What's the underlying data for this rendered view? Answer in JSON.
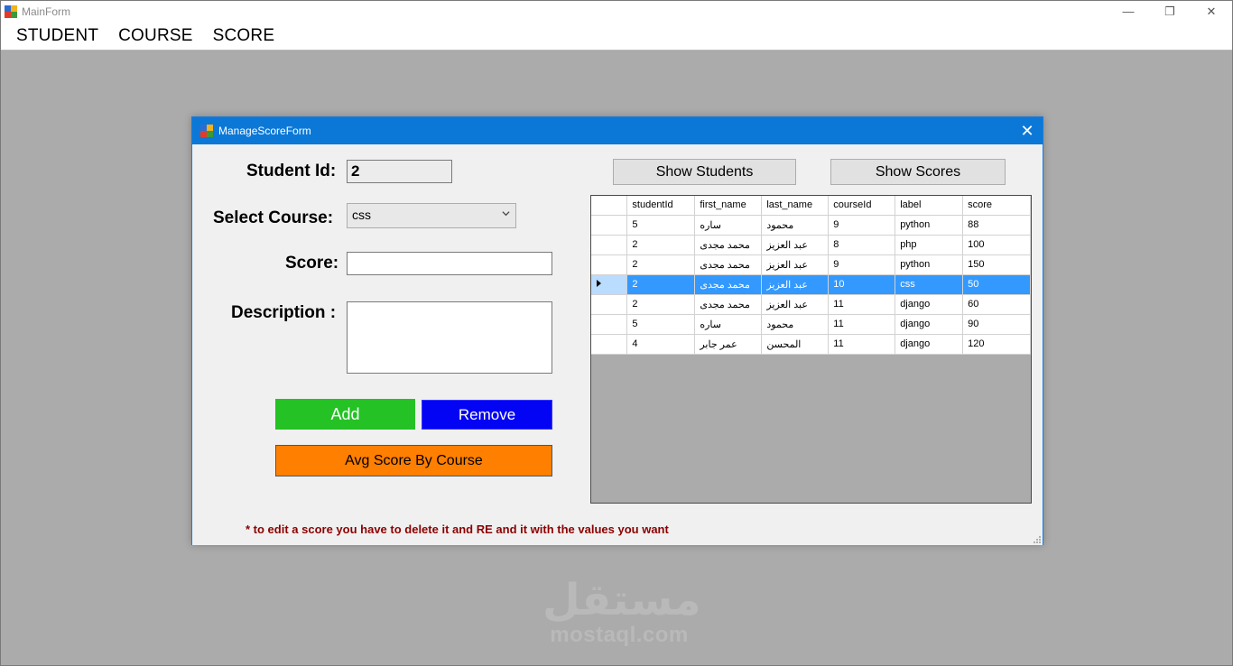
{
  "main_window": {
    "title": "MainForm",
    "controls": {
      "minimize": "—",
      "restore": "❐",
      "close": "✕"
    },
    "menu": [
      "STUDENT",
      "COURSE",
      "SCORE"
    ]
  },
  "child_window": {
    "title": "ManageScoreForm",
    "close": "✕",
    "labels": {
      "student_id": "Student Id:",
      "select_course": "Select Course:",
      "score": "Score:",
      "description": "Description :"
    },
    "fields": {
      "student_id_value": "2",
      "course_selected": "css",
      "score_value": "",
      "description_value": ""
    },
    "buttons": {
      "show_students": "Show Students",
      "show_scores": "Show Scores",
      "add": "Add",
      "remove": "Remove",
      "avg": "Avg Score By Course"
    },
    "grid": {
      "columns": [
        "studentId",
        "first_name",
        "last_name",
        "courseId",
        "label",
        "score"
      ],
      "rows": [
        [
          "5",
          "ساره",
          "محمود",
          "9",
          "python",
          "88"
        ],
        [
          "2",
          "محمد مجدى",
          "عبد العزيز",
          "8",
          "php",
          "100"
        ],
        [
          "2",
          "محمد مجدى",
          "عبد العزيز",
          "9",
          "python",
          "150"
        ],
        [
          "2",
          "محمد مجدى",
          "عبد العزيز",
          "10",
          "css",
          "50"
        ],
        [
          "2",
          "محمد مجدى",
          "عبد العزيز",
          "11",
          "django",
          "60"
        ],
        [
          "5",
          "ساره",
          "محمود",
          "11",
          "django",
          "90"
        ],
        [
          "4",
          "عمر جابر",
          "المحسن",
          "11",
          "django",
          "120"
        ]
      ],
      "selected_row": 3
    },
    "note": "* to edit a score you have to delete it and RE and it with the values you want"
  },
  "watermark": {
    "arabic": "مستقل",
    "latin": "mostaql.com"
  },
  "colors": {
    "add": "#24c224",
    "remove": "#0404f4",
    "avg": "#ff7f00",
    "titlebar": "#0b78d7",
    "selection": "#3399ff",
    "note": "#8b0000"
  }
}
